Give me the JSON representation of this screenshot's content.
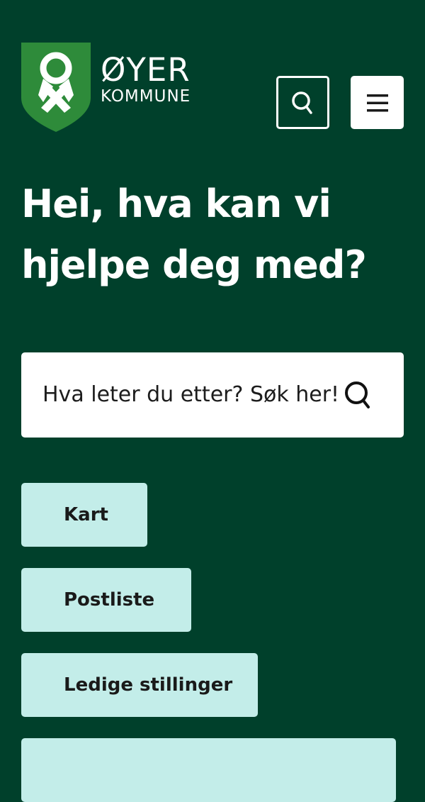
{
  "header": {
    "logo": {
      "name": "ØYER",
      "subtitle": "KOMMUNE",
      "icon": "shield-logo-icon",
      "colors": {
        "shield": "#2e8b3a",
        "emblem": "#ffffff"
      }
    },
    "search_button": {
      "icon": "search-icon"
    },
    "menu_button": {
      "icon": "hamburger-menu-icon"
    }
  },
  "hero": {
    "title": "Hei, hva kan vi hjelpe deg med?"
  },
  "search": {
    "placeholder": "Hva leter du etter? Søk her!",
    "icon": "search-icon"
  },
  "quick_links": [
    {
      "label": "Kart"
    },
    {
      "label": "Postliste"
    },
    {
      "label": "Ledige stillinger"
    },
    {
      "label": ""
    }
  ],
  "colors": {
    "background": "#00402b",
    "quick_link_background": "#c3ede9",
    "text_on_dark": "#ffffff",
    "text_on_light": "#1a1a1a"
  }
}
